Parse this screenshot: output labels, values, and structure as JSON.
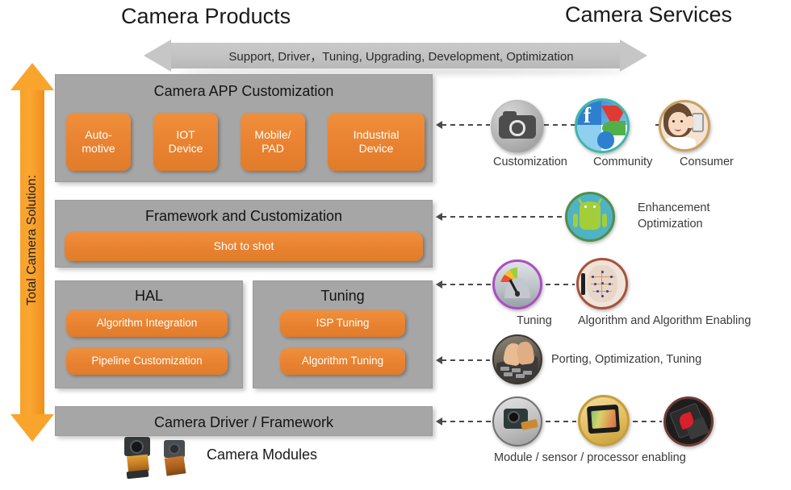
{
  "headings": {
    "products": "Camera Products",
    "services": "Camera Services"
  },
  "top_arrow": {
    "label": "Support, Driver，Tuning, Upgrading, Development, Optimization",
    "direction": "double",
    "color": "#c6c6c6"
  },
  "left_arrow": {
    "label": "Total Camera Solution:",
    "direction": "double-vertical",
    "color": "#f9a42c"
  },
  "stack": {
    "app": {
      "title": "Camera APP Customization",
      "items": [
        {
          "label": "Auto-\nmotive",
          "line1": "Auto-",
          "line2": "motive"
        },
        {
          "label": "IOT Device",
          "line1": "IOT",
          "line2": "Device"
        },
        {
          "label": "Mobile/ PAD",
          "line1": "Mobile/",
          "line2": "PAD"
        },
        {
          "label": "Industrial Device",
          "line1": "Industrial",
          "line2": "Device"
        }
      ]
    },
    "framework": {
      "title": "Framework and Customization",
      "items": [
        {
          "label": "Shot to shot"
        }
      ]
    },
    "hal": {
      "title": "HAL",
      "items": [
        {
          "label": "Algorithm Integration"
        },
        {
          "label": "Pipeline Customization"
        }
      ]
    },
    "tuning": {
      "title": "Tuning",
      "items": [
        {
          "label": "ISP Tuning"
        },
        {
          "label": "Algorithm Tuning"
        }
      ]
    },
    "driver": {
      "title": "Camera Driver / Framework"
    },
    "modules": {
      "label": "Camera Modules"
    }
  },
  "services": {
    "row_app": {
      "icons": [
        {
          "name": "camera-icon",
          "label": "Customization"
        },
        {
          "name": "community-social-icon",
          "label": "Community"
        },
        {
          "name": "consumer-person-icon",
          "label": "Consumer"
        }
      ]
    },
    "row_framework": {
      "icons": [
        {
          "name": "android-icon",
          "label": "Enhancement\nOptimization",
          "line1": "Enhancement",
          "line2": "Optimization"
        }
      ]
    },
    "row_tuning": {
      "icons": [
        {
          "name": "gauge-tuning-icon",
          "label": "Tuning"
        },
        {
          "name": "face-algorithm-icon",
          "label": "Algorithm and Algorithm Enabling"
        }
      ]
    },
    "row_porting": {
      "icons": [
        {
          "name": "keyboard-hands-icon",
          "label": "Porting, Optimization,  Tuning"
        }
      ]
    },
    "row_driver": {
      "icons": [
        {
          "name": "camera-module-icon",
          "label": ""
        },
        {
          "name": "image-sensor-icon",
          "label": ""
        },
        {
          "name": "processor-chip-icon",
          "label": ""
        }
      ],
      "label": "Module / sensor / processor enabling"
    }
  },
  "colors": {
    "panel_gray": "#a6a6a6",
    "box_orange": "#e98230",
    "arrow_orange": "#f9a42c",
    "arrow_gray": "#c6c6c6",
    "text_dark": "#262626"
  }
}
